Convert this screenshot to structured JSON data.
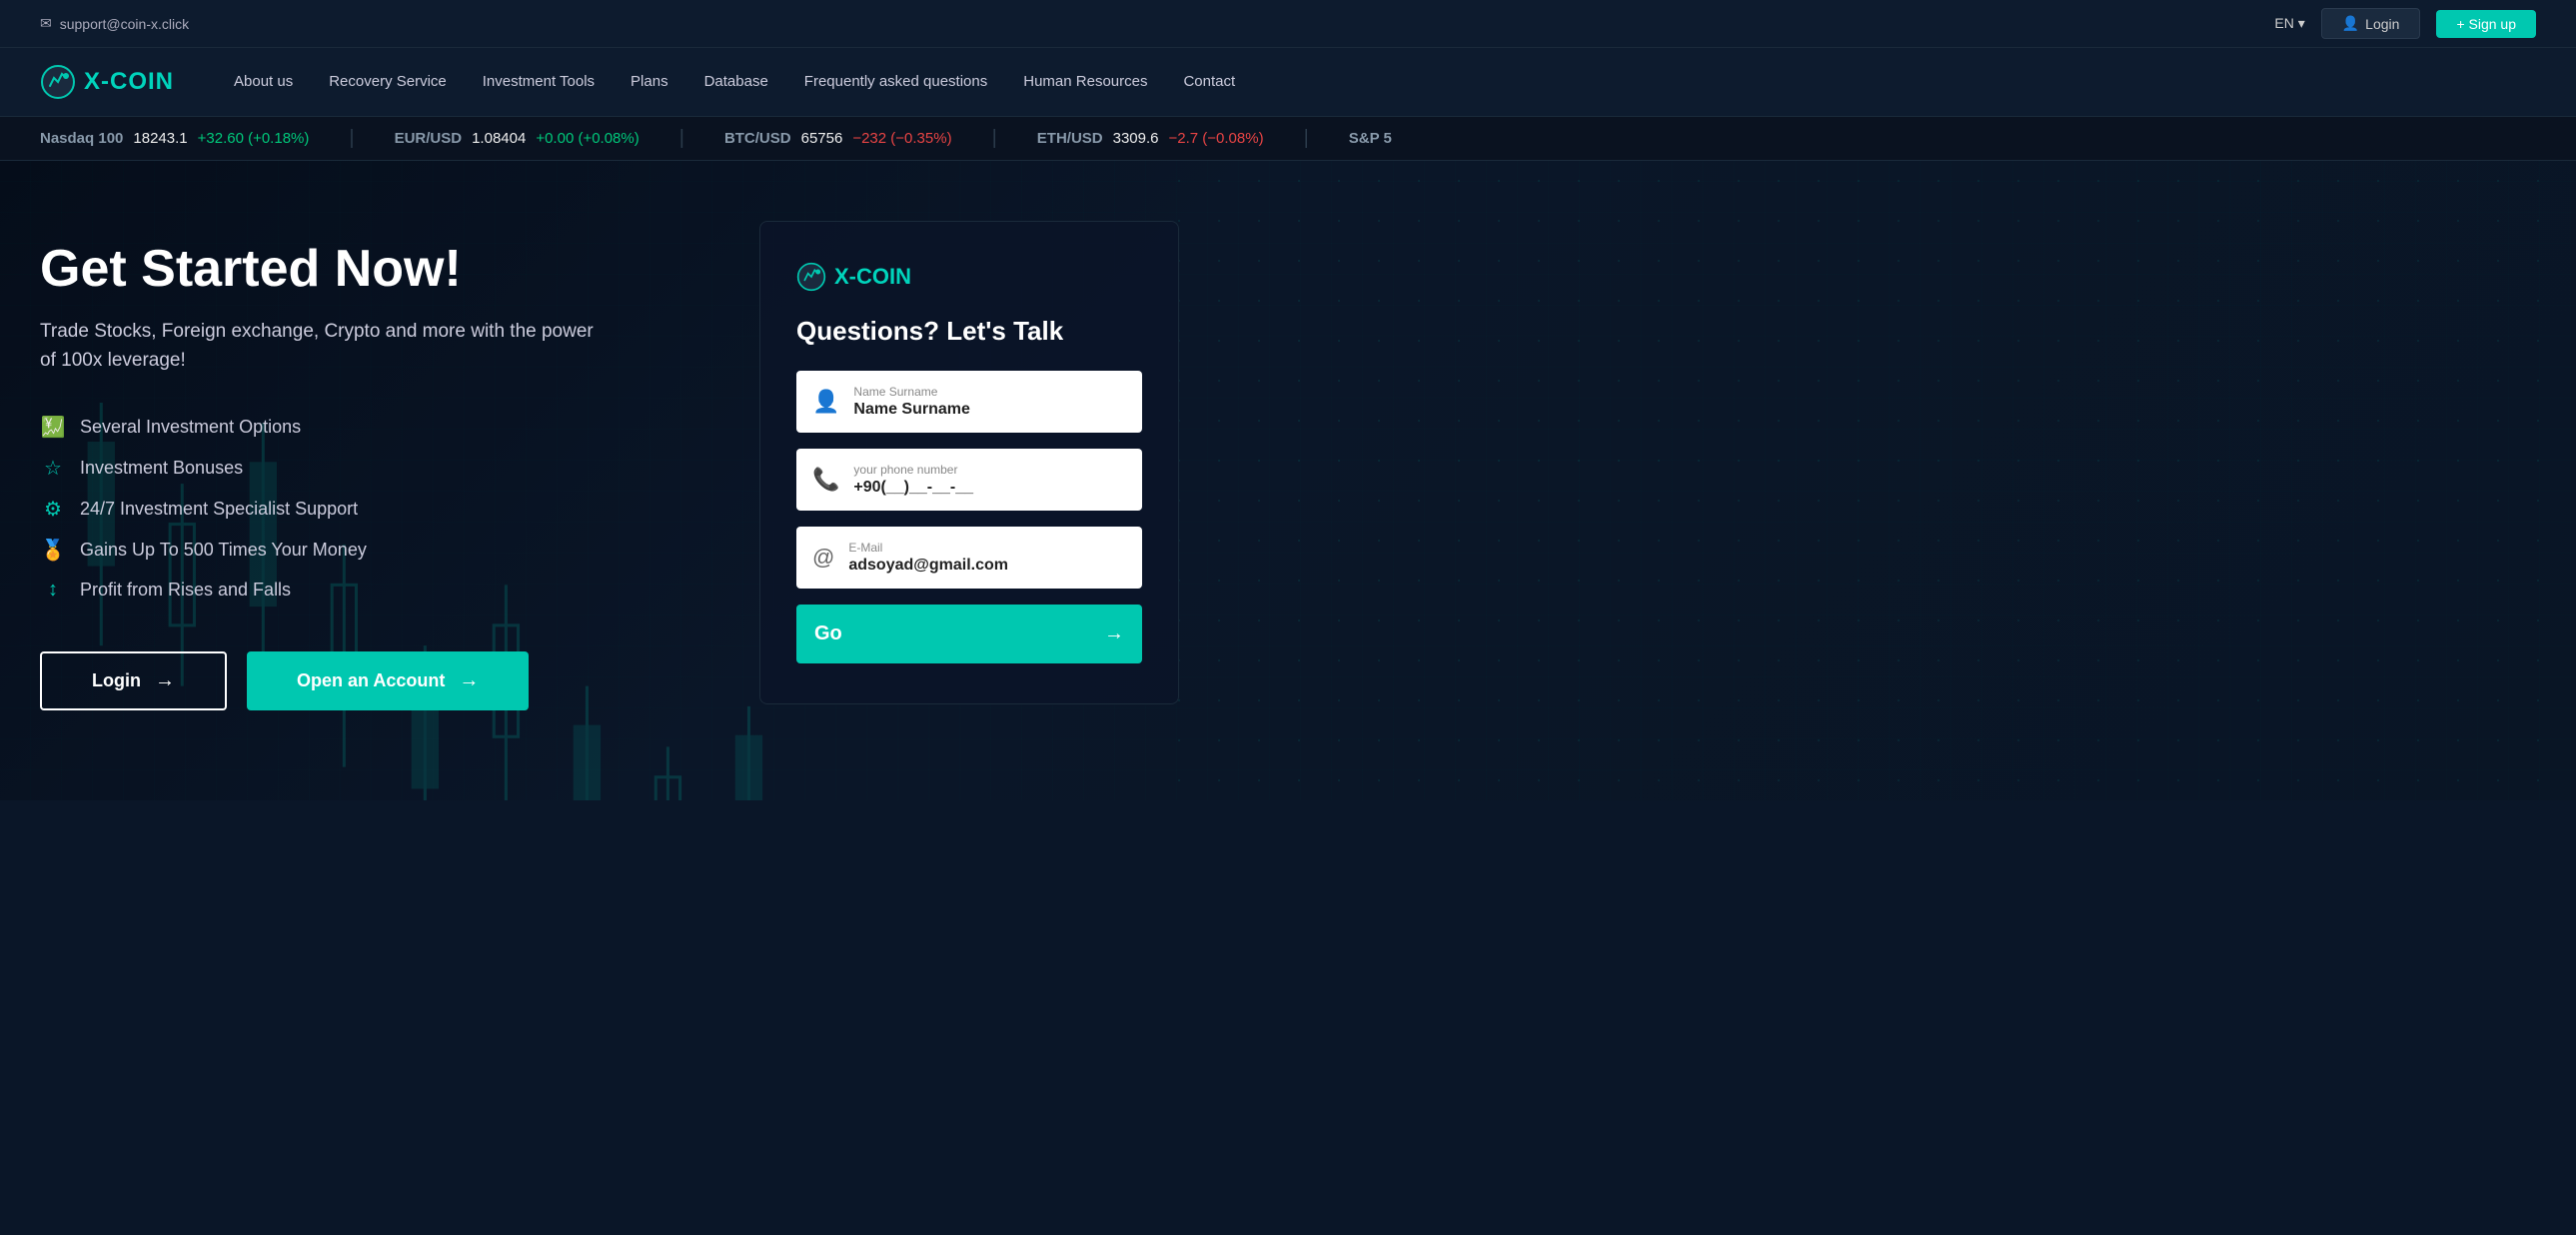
{
  "topbar": {
    "email": "support@coin-x.click",
    "lang": "EN",
    "lang_dropdown": "▾",
    "login_label": "Login",
    "signup_label": "+ Sign up"
  },
  "nav": {
    "logo_text": "X-COIN",
    "links": [
      {
        "label": "About us"
      },
      {
        "label": "Recovery Service"
      },
      {
        "label": "Investment Tools"
      },
      {
        "label": "Plans"
      },
      {
        "label": "Database"
      },
      {
        "label": "Frequently asked questions"
      },
      {
        "label": "Human Resources"
      },
      {
        "label": "Contact"
      }
    ]
  },
  "ticker": [
    {
      "label": "Nasdaq 100",
      "value": "18243.1",
      "change": "+32.60 (+0.18%)",
      "positive": true
    },
    {
      "label": "EUR/USD",
      "value": "1.08404",
      "change": "+0.00 (+0.08%)",
      "positive": true
    },
    {
      "label": "BTC/USD",
      "value": "65756",
      "change": "−232 (−0.35%)",
      "positive": false
    },
    {
      "label": "ETH/USD",
      "value": "3309.6",
      "change": "−2.7 (−0.08%)",
      "positive": false
    },
    {
      "label": "S&P 5",
      "value": "",
      "change": "",
      "positive": true
    }
  ],
  "hero": {
    "title": "Get Started Now!",
    "subtitle": "Trade Stocks, Foreign exchange, Crypto and more with the power of 100x leverage!",
    "features": [
      {
        "icon": "💹",
        "text": "Several Investment Options"
      },
      {
        "icon": "⭐",
        "text": "Investment Bonuses"
      },
      {
        "icon": "⚙️",
        "text": "24/7 Investment Specialist Support"
      },
      {
        "icon": "🏆",
        "text": "Gains Up To 500 Times Your Money"
      },
      {
        "icon": "↕️",
        "text": "Profit from Rises and Falls"
      }
    ],
    "login_btn": "Login",
    "account_btn": "Open an Account"
  },
  "contact_card": {
    "logo_text": "X-COIN",
    "title": "Questions? Let's Talk",
    "name_label": "Name Surname",
    "name_value": "Name Surname",
    "phone_label": "your phone number",
    "phone_value": "+90(__)__-__-__",
    "email_label": "E-Mail",
    "email_value": "adsoyad@gmail.com",
    "go_label": "Go"
  }
}
